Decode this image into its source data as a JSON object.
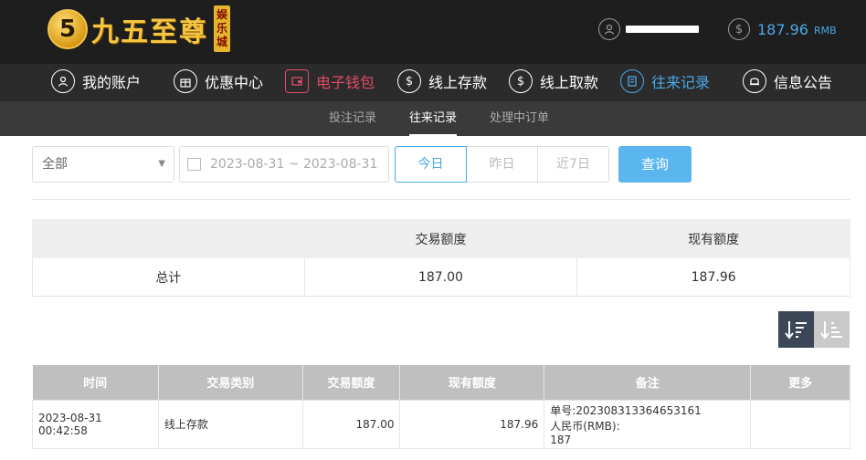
{
  "brand": {
    "logo_char": "5",
    "name": "九五至尊",
    "badge": "娱乐城"
  },
  "user": {
    "balance": "187.96",
    "unit": "RMB",
    "user_icon": "user-icon",
    "dollar_icon": "dollar-icon"
  },
  "nav": [
    {
      "label": "我的账户",
      "icon": "user-icon"
    },
    {
      "label": "优惠中心",
      "icon": "gift-icon"
    },
    {
      "label": "电子钱包",
      "icon": "wallet-icon"
    },
    {
      "label": "线上存款",
      "icon": "deposit-icon"
    },
    {
      "label": "线上取款",
      "icon": "withdraw-icon"
    },
    {
      "label": "往来记录",
      "icon": "record-icon"
    },
    {
      "label": "信息公告",
      "icon": "bell-icon"
    }
  ],
  "subnav": [
    {
      "label": "投注记录"
    },
    {
      "label": "往来记录"
    },
    {
      "label": "处理中订单"
    }
  ],
  "filter": {
    "type_value": "全部",
    "date_range": "2023-08-31 ~ 2023-08-31",
    "btn_today": "今日",
    "btn_yesterday": "昨日",
    "btn_7days": "近7日",
    "btn_query": "查询"
  },
  "summary": {
    "col_amount": "交易额度",
    "col_balance": "现有额度",
    "row_label": "总计",
    "amount": "187.00",
    "balance": "187.96"
  },
  "records": {
    "headers": [
      "时间",
      "交易类别",
      "交易额度",
      "现有额度",
      "备注",
      "更多"
    ],
    "rows": [
      {
        "time": "2023-08-31 00:42:58",
        "type": "线上存款",
        "amount": "187.00",
        "balance": "187.96",
        "note_line1": "单号:202308313364653161",
        "note_line2": "人民币(RMB):",
        "note_line3": "187",
        "more": ""
      }
    ]
  },
  "colors": {
    "accent": "#4aa8e8",
    "wallet": "#e24b6a",
    "header_bg": "#1e1e1e"
  }
}
